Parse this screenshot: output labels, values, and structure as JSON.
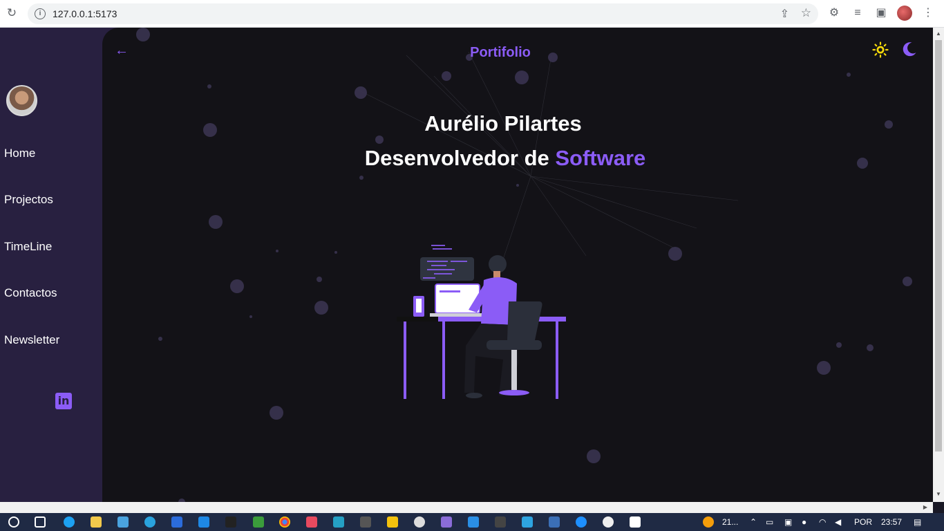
{
  "browser": {
    "url": "127.0.0.1:5173"
  },
  "sidebar": {
    "items": [
      {
        "label": "Home"
      },
      {
        "label": "Projectos"
      },
      {
        "label": "TimeLine"
      },
      {
        "label": "Contactos"
      },
      {
        "label": "Newsletter"
      }
    ],
    "social_icon": "linkedin-icon"
  },
  "header": {
    "title": "Portifolio",
    "back_icon": "arrow-left-icon",
    "theme_icons": [
      "sun-icon",
      "moon-icon"
    ]
  },
  "hero": {
    "name": "Aurélio Pilartes",
    "role_prefix": "Desenvolvedor de",
    "role_accent": "Software",
    "illustration": "developer-at-desk-illustration"
  },
  "taskbar": {
    "weather": "21...",
    "language": "POR",
    "time": "23:57"
  },
  "colors": {
    "accent": "#8b5cf6",
    "sidebar_bg": "#282040",
    "main_bg": "#131217",
    "sun": "#f5d90a"
  }
}
